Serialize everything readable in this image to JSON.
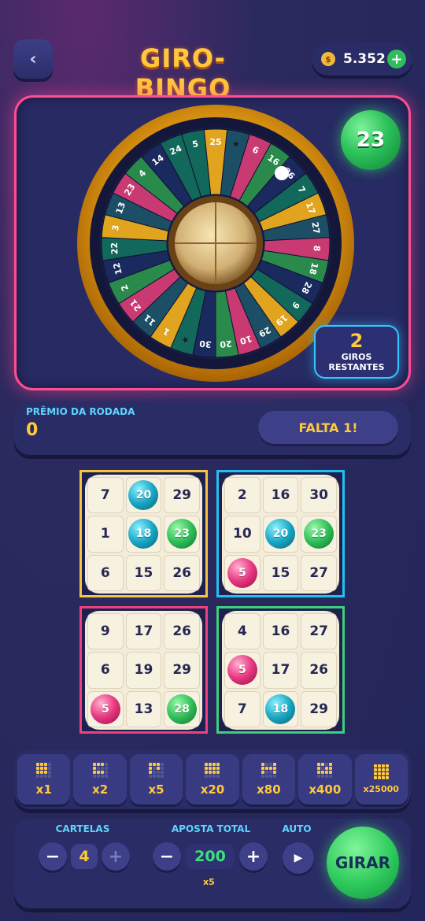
{
  "header": {
    "back_icon": "chevron-left-icon",
    "title": "GIRO-BINGO",
    "balance": "5.352",
    "coin_symbol": "$"
  },
  "wheel": {
    "drawn_ball": "23",
    "spins_count": "2",
    "spins_label_1": "GIROS",
    "spins_label_2": "RESTANTES",
    "segments": [
      "5",
      "25",
      "★",
      "6",
      "16",
      "26",
      "7",
      "17",
      "27",
      "8",
      "18",
      "28",
      "9",
      "19",
      "29",
      "10",
      "20",
      "30",
      "★",
      "1",
      "11",
      "21",
      "2",
      "12",
      "22",
      "3",
      "13",
      "23",
      "4",
      "14",
      "24"
    ]
  },
  "prize": {
    "label": "PRÊMIO DA RODADA",
    "value": "0",
    "status": "FALTA 1!"
  },
  "cards": [
    {
      "color": "#f5c542",
      "cells": [
        "7",
        "20",
        "29",
        "1",
        "18",
        "23",
        "6",
        "15",
        "26"
      ],
      "marks": [
        "",
        "teal",
        "",
        "",
        "teal",
        "green",
        "",
        "",
        ""
      ]
    },
    {
      "color": "#22c2f0",
      "cells": [
        "2",
        "16",
        "30",
        "10",
        "20",
        "23",
        "5",
        "15",
        "27"
      ],
      "marks": [
        "",
        "",
        "",
        "",
        "teal",
        "green",
        "pink",
        "",
        ""
      ]
    },
    {
      "color": "#f0407f",
      "cells": [
        "9",
        "17",
        "26",
        "6",
        "19",
        "29",
        "5",
        "13",
        "28"
      ],
      "marks": [
        "",
        "",
        "",
        "",
        "",
        "",
        "pink",
        "",
        "green"
      ]
    },
    {
      "color": "#3ed07a",
      "cells": [
        "4",
        "16",
        "27",
        "5",
        "17",
        "26",
        "7",
        "18",
        "29"
      ],
      "marks": [
        "",
        "",
        "",
        "pink",
        "",
        "",
        "",
        "teal",
        ""
      ]
    }
  ],
  "multipliers": [
    "x1",
    "x2",
    "x5",
    "x20",
    "x80",
    "x400",
    "x25000"
  ],
  "controls": {
    "cards_label": "CARTELAS",
    "cards_value": "4",
    "bet_label": "APOSTA TOTAL",
    "bet_value": "200",
    "bet_multiplier": "x5",
    "auto_label": "AUTO",
    "spin_label": "GIRAR",
    "minus": "−",
    "plus": "+"
  }
}
